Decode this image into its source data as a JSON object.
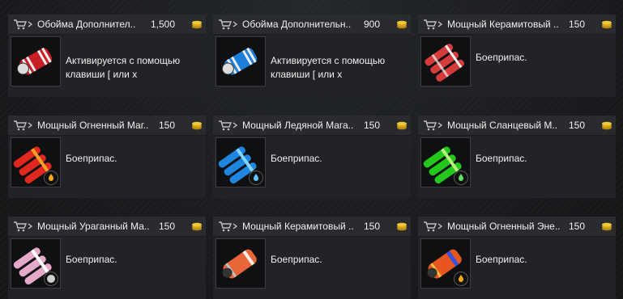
{
  "cards": [
    {
      "title": "Обойма Дополнител..",
      "price": "1,500",
      "desc": "Активируется с помощью клавиши [ или x",
      "icon": "red-clip-icon",
      "color": "#d0242a"
    },
    {
      "title": "Обойма Дополнительн..",
      "price": "900",
      "desc": "Активируется с помощью клавиши [ или x",
      "icon": "blue-clip-icon",
      "color": "#1e7fd8"
    },
    {
      "title": "Мощный Керамитовый ..",
      "price": "150",
      "desc": "Боеприпас.",
      "icon": "red-ceramite-ammo-icon",
      "color": "#d63b3b"
    },
    {
      "title": "Мощный Огненный Маг..",
      "price": "150",
      "desc": "Боеприпас.",
      "icon": "fire-magic-ammo-icon",
      "color": "#e0281e",
      "element": "fire-element-icon"
    },
    {
      "title": "Мощный Ледяной Мага..",
      "price": "150",
      "desc": "Боеприпас.",
      "icon": "ice-magic-ammo-icon",
      "color": "#1f86e0",
      "element": "ice-element-icon"
    },
    {
      "title": "Мощный Сланцевый М..",
      "price": "150",
      "desc": "Боеприпас.",
      "icon": "slate-magic-ammo-icon",
      "color": "#22c81c",
      "element": "earth-element-icon"
    },
    {
      "title": "Мощный Ураганный Ма..",
      "price": "150",
      "desc": "Боеприпас.",
      "icon": "storm-magic-ammo-icon",
      "color": "#e6a8c8",
      "element": "wind-element-icon"
    },
    {
      "title": "Мощный Керамитовый ..",
      "price": "150",
      "desc": "Боеприпас.",
      "icon": "orange-ceramite-ammo-icon",
      "color": "#e8663a"
    },
    {
      "title": "Мощный Огненный Эне..",
      "price": "150",
      "desc": "Боеприпас.",
      "icon": "fire-energy-ammo-icon",
      "color": "#e8551f",
      "element": "fire-element-icon"
    }
  ]
}
